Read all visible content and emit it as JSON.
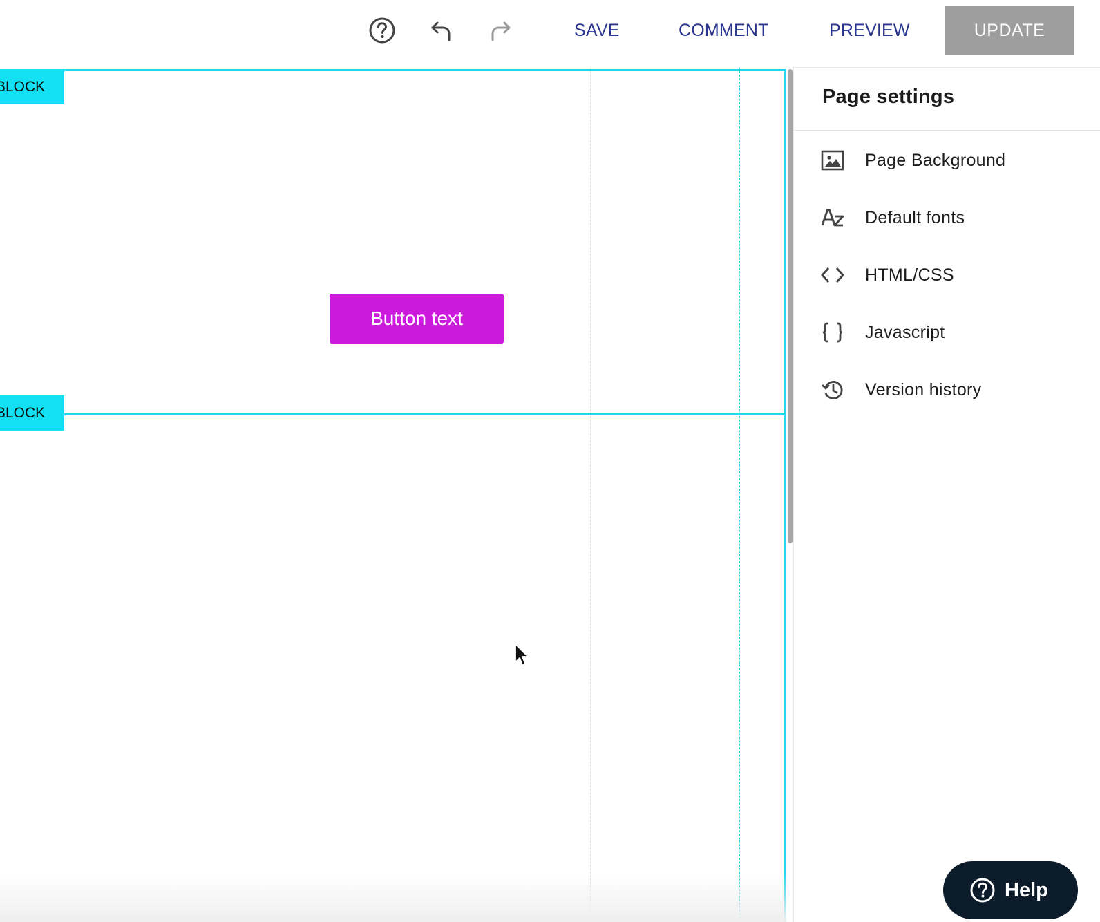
{
  "toolbar": {
    "help_icon": "help-circle-icon",
    "undo_icon": "undo-icon",
    "redo_icon": "redo-icon",
    "save_label": "SAVE",
    "comment_label": "COMMENT",
    "preview_label": "PREVIEW",
    "update_label": "UPDATE",
    "link_color": "#2a3590",
    "update_bg": "#9e9e9e"
  },
  "canvas": {
    "block_tags": [
      "BLOCK",
      "BLOCK"
    ],
    "button_text": "Button text",
    "button_color": "#cc1adc",
    "outline_color": "#22d6ec"
  },
  "panel": {
    "title": "Page settings",
    "items": [
      {
        "label": "Page Background",
        "icon": "image-icon"
      },
      {
        "label": "Default fonts",
        "icon": "font-az-icon"
      },
      {
        "label": "HTML/CSS",
        "icon": "code-brackets-icon"
      },
      {
        "label": "Javascript",
        "icon": "curly-braces-icon"
      },
      {
        "label": "Version history",
        "icon": "history-icon"
      }
    ]
  },
  "help_widget": {
    "label": "Help",
    "icon": "help-circle-icon",
    "bg": "#0d1c2a"
  }
}
